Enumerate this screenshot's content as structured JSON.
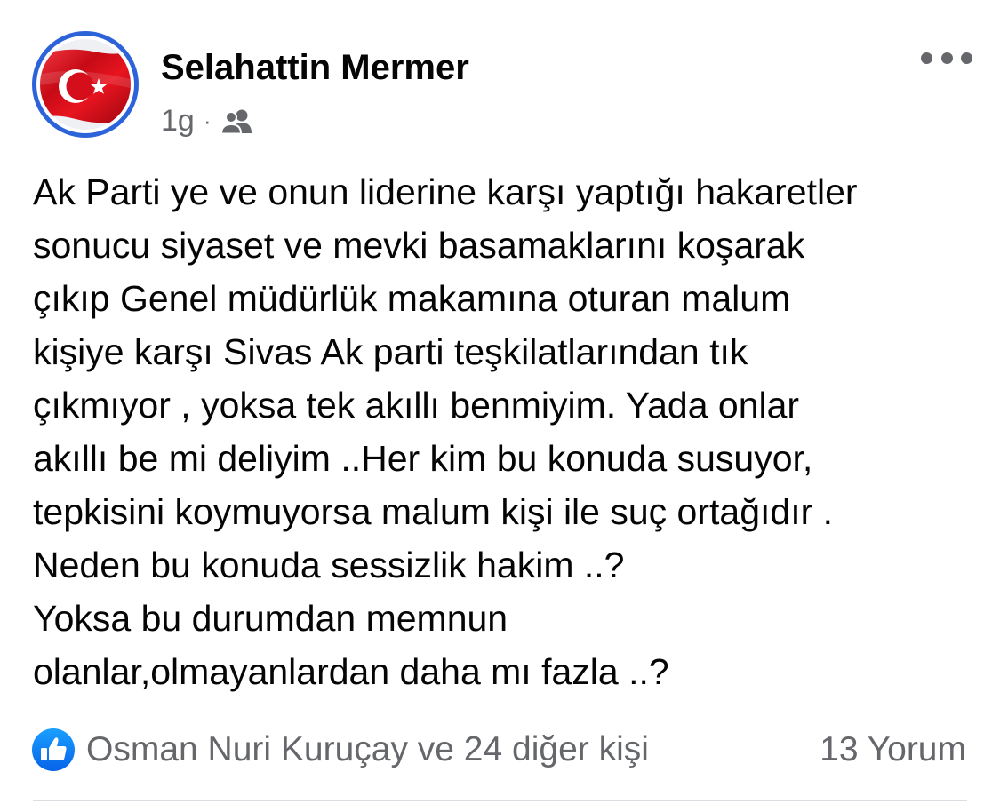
{
  "post": {
    "author": "Selahattin Mermer",
    "timestamp": "1g",
    "separator": "·",
    "audience_icon": "friends-icon",
    "avatar_icon": "turkish-flag-avatar",
    "more_icon": "more-options-icon",
    "text": "Ak Parti ye ve onun liderine karşı yaptığı hakaretler\nsonucu siyaset ve mevki basamaklarını  koşarak\nçıkıp Genel müdürlük makamına oturan malum\nkişiye karşı Sivas Ak parti teşkilatlarından tık\nçıkmıyor , yoksa tek akıllı benmiyim. Yada onlar\nakıllı be mi deliyim ..Her kim bu konuda susuyor,\ntepkisini koymuyorsa malum kişi ile suç ortağıdır .\nNeden bu konuda sessizlik hakim ..?\nYoksa bu durumdan memnun\nolanlar,olmayanlardan daha mı fazla ..?",
    "reactions": {
      "icon": "like-icon",
      "text": "Osman Nuri Kuruçay ve 24 diğer kişi"
    },
    "comments": "13 Yorum"
  },
  "colors": {
    "text": "#050505",
    "secondary": "#65676b",
    "like_blue": "#1877f2",
    "avatar_ring": "#2d63d9",
    "flag_red": "#e30a17"
  }
}
